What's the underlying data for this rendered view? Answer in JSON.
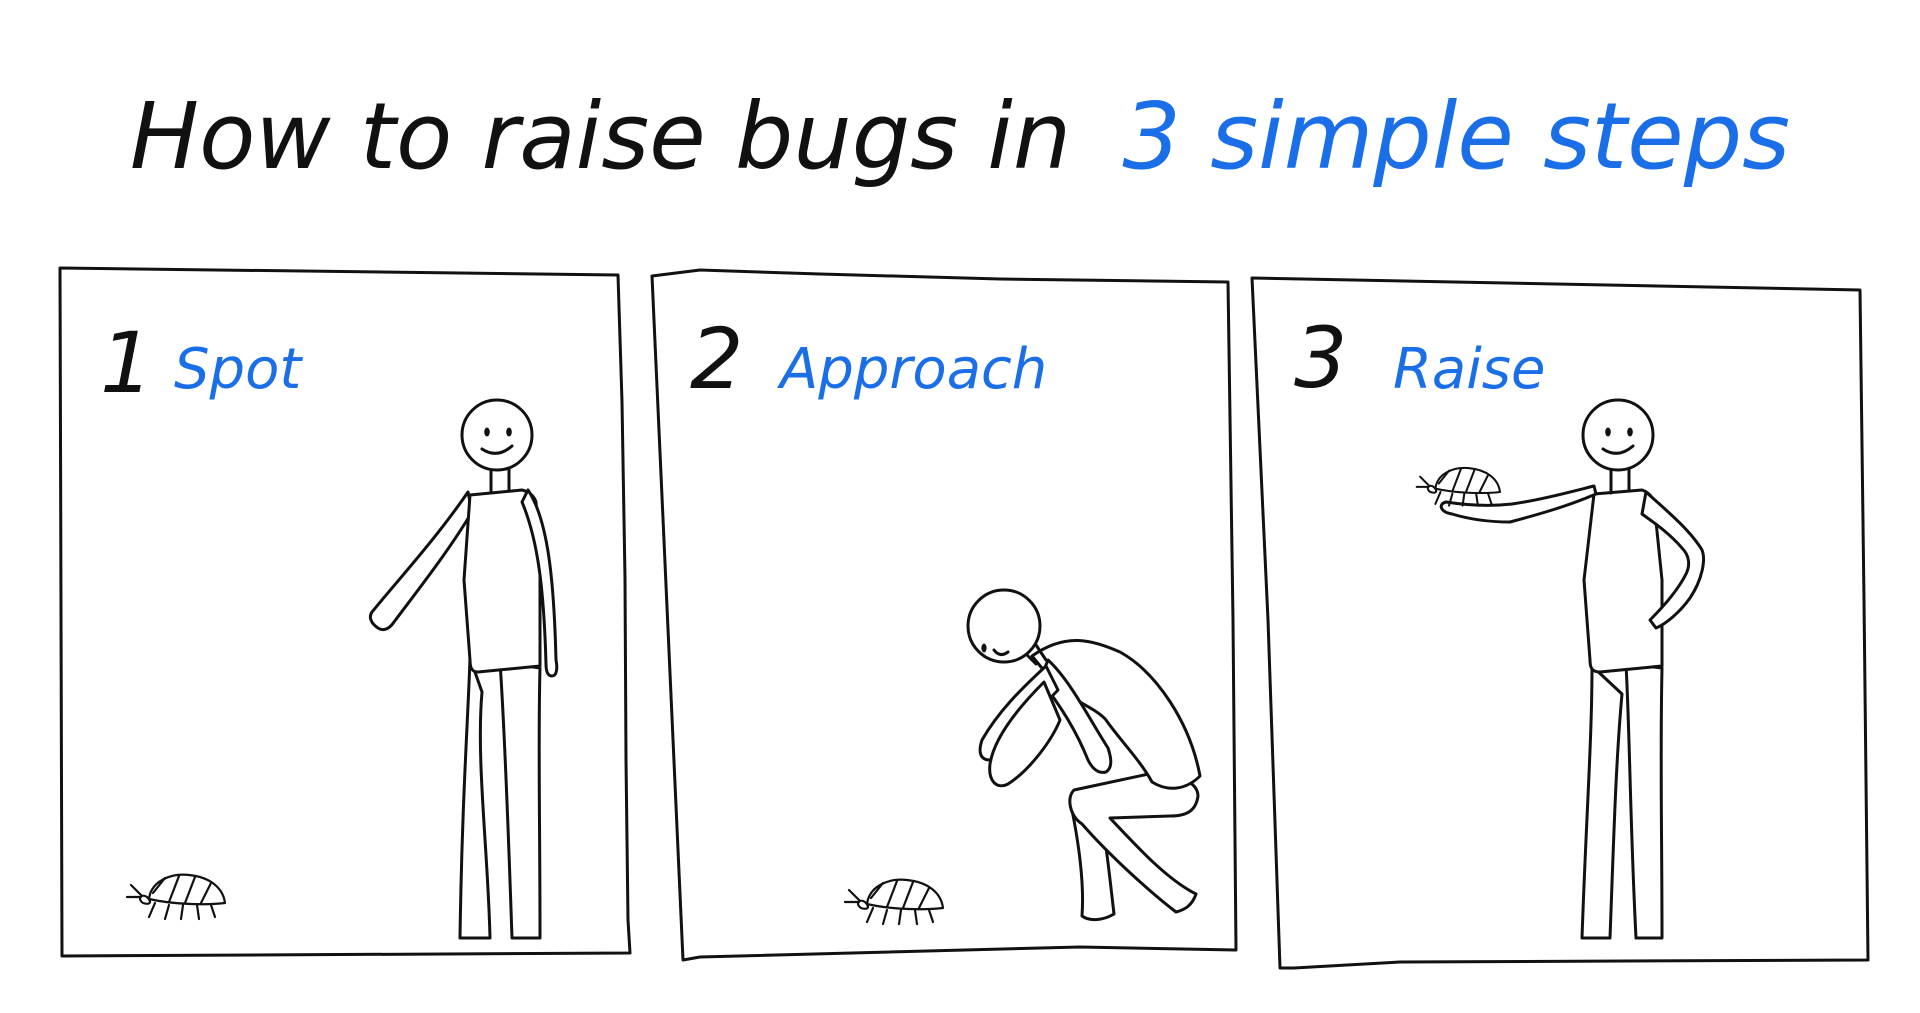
{
  "title": {
    "lead": "How to raise bugs in",
    "highlight": "3 simple steps"
  },
  "colors": {
    "ink": "#111111",
    "accent": "#1a6ee8",
    "paper": "#ffffff"
  },
  "panels": [
    {
      "number": "1",
      "label": "Spot"
    },
    {
      "number": "2",
      "label": "Approach"
    },
    {
      "number": "3",
      "label": "Raise"
    }
  ]
}
